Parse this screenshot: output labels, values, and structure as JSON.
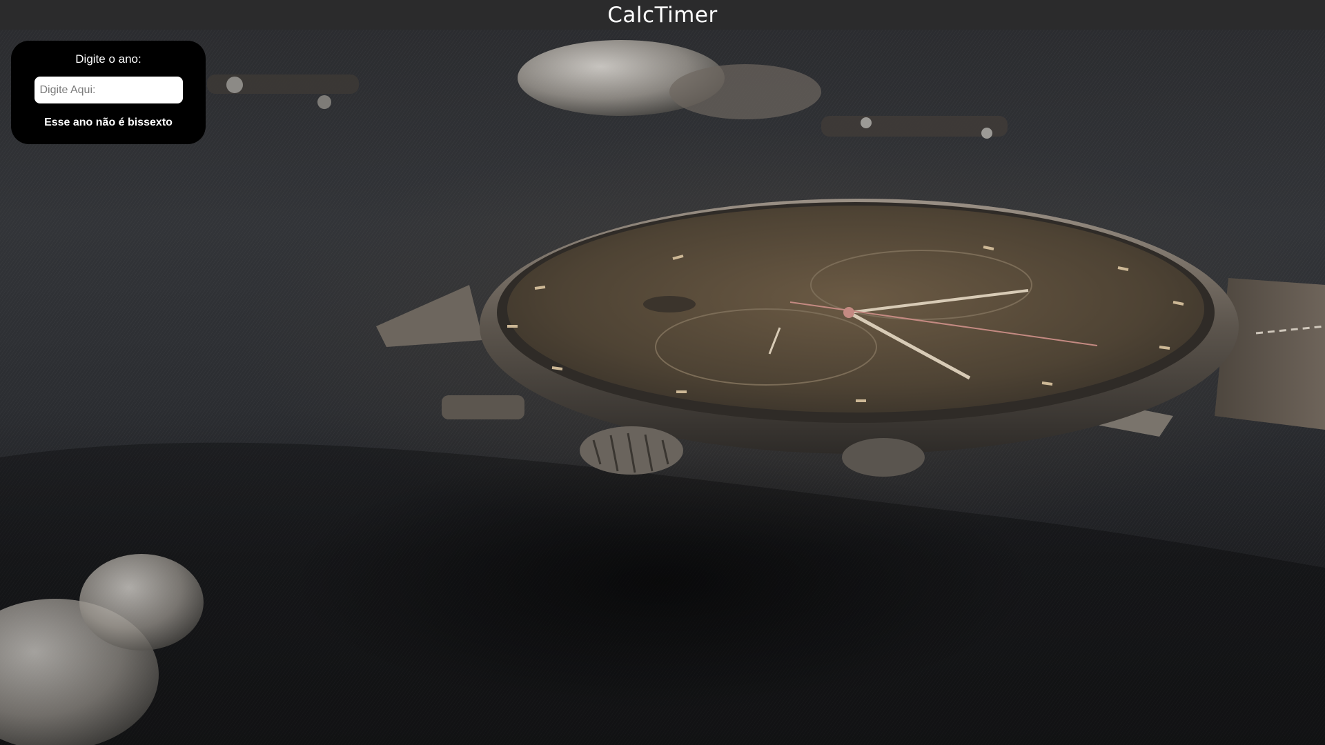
{
  "header": {
    "title": "CalcTimer"
  },
  "leap_year_form": {
    "label": "Digite o ano:",
    "input_value": "",
    "input_placeholder": "Digite Aqui:",
    "result_text": "Esse ano não é bissexto"
  },
  "background": {
    "subject": "wristwatch-on-fabric-photo"
  },
  "colors": {
    "header_bg": "#2b2b2c",
    "card_bg": "#000000",
    "text": "#ffffff"
  }
}
